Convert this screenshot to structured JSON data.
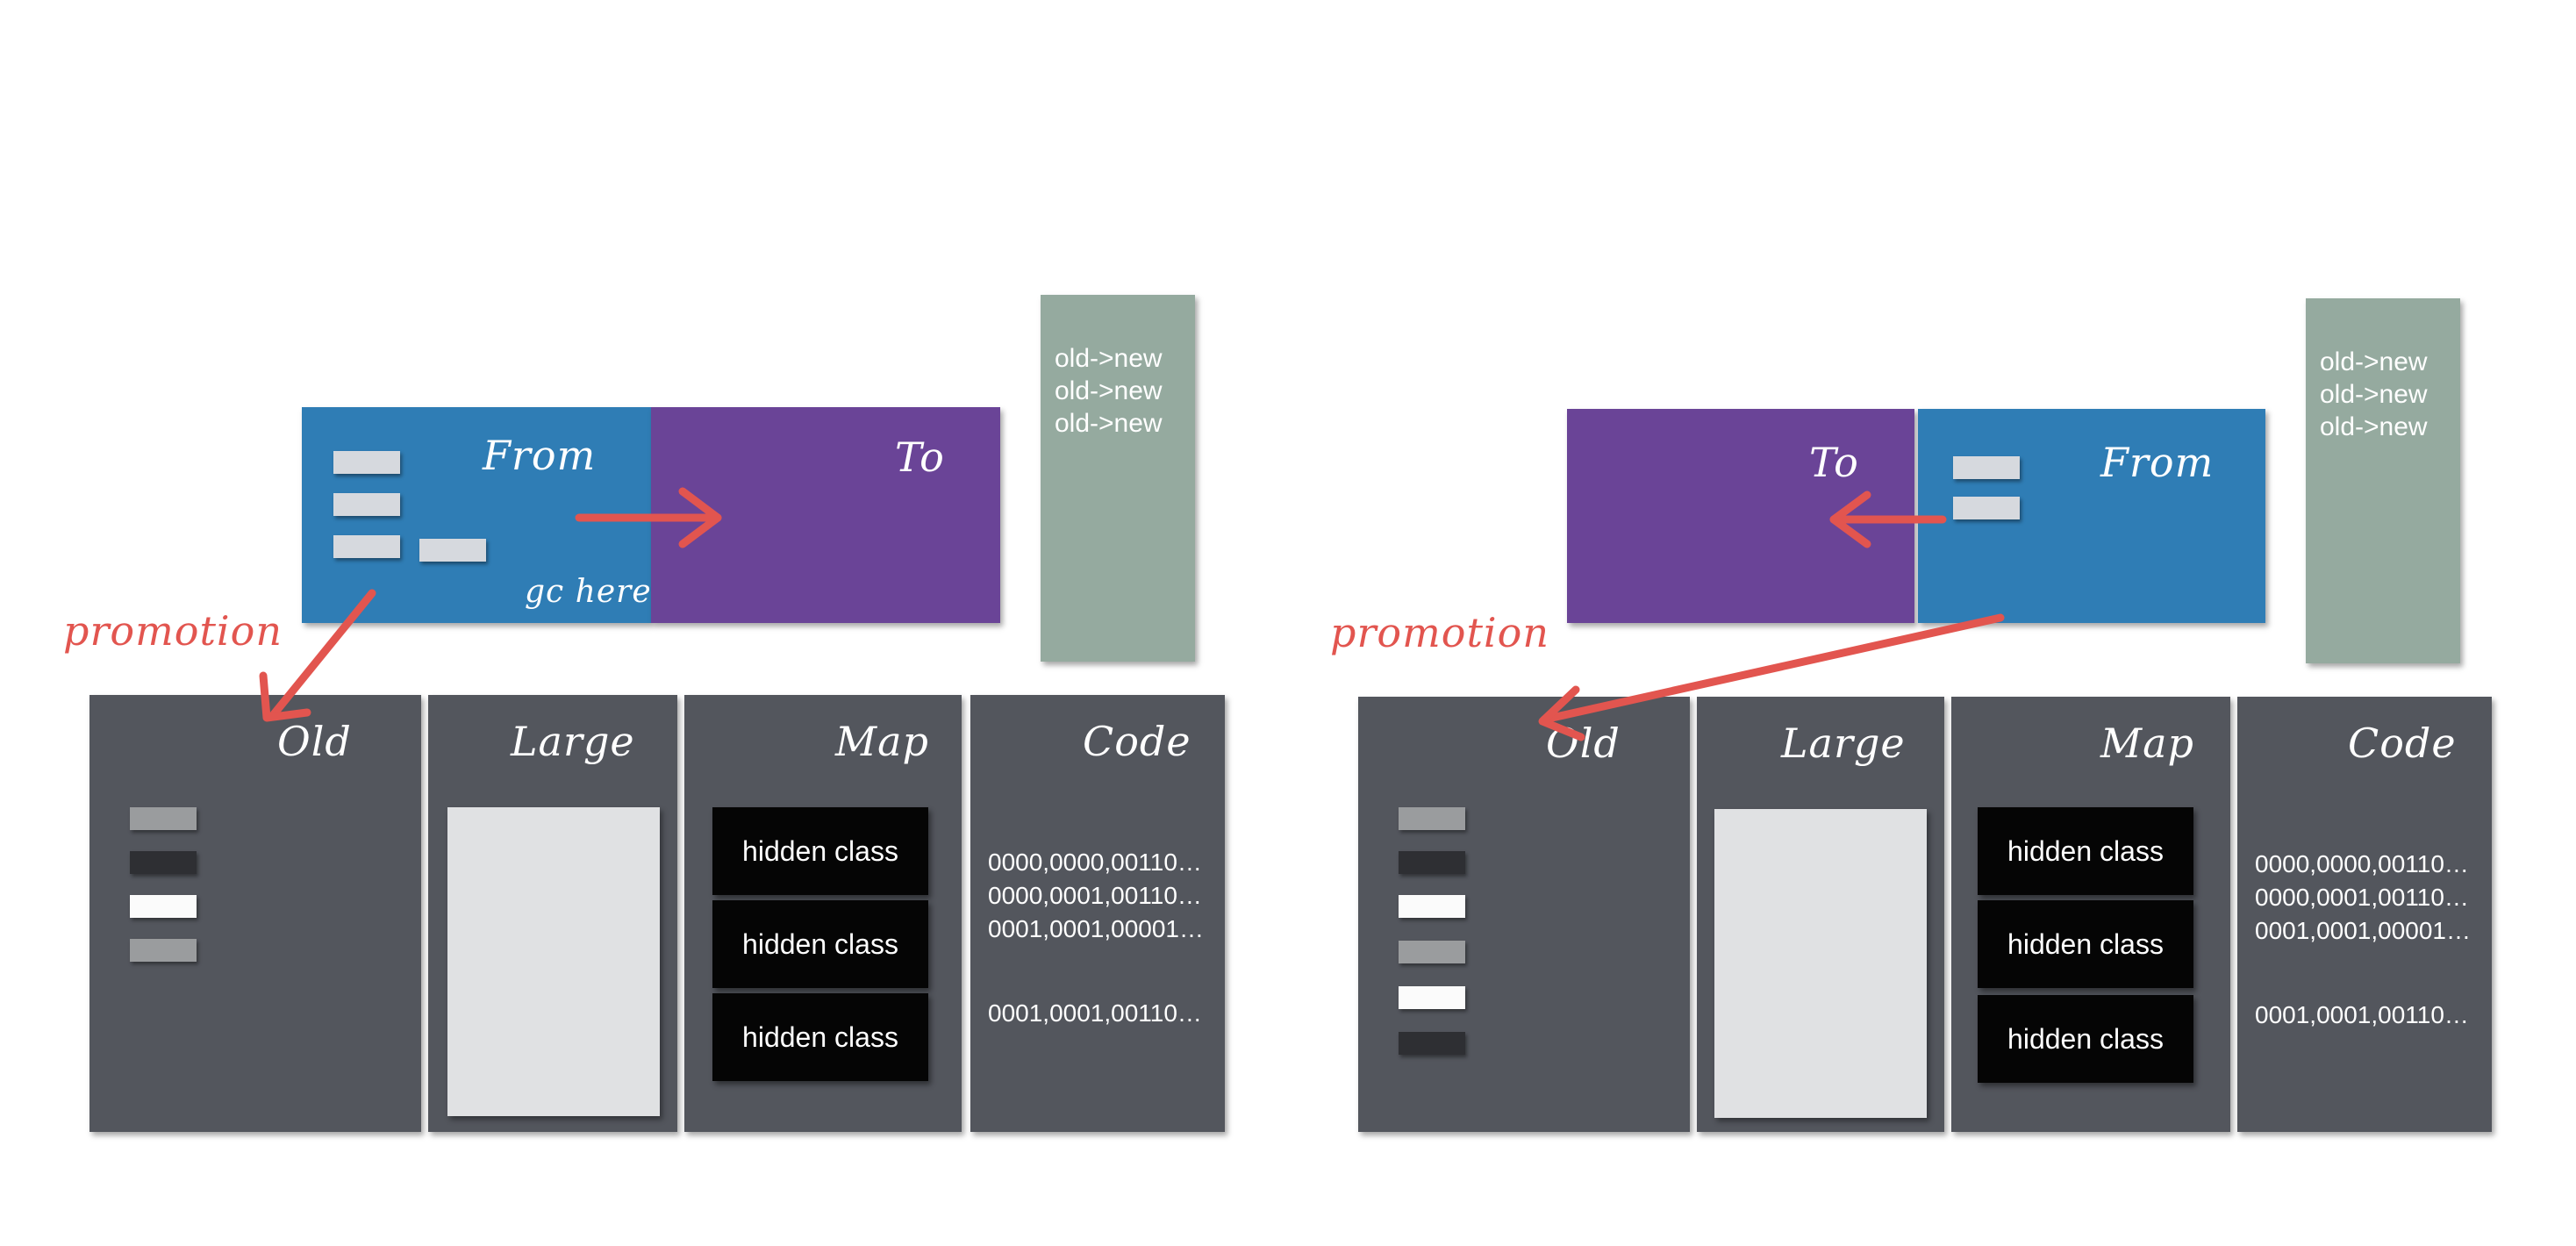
{
  "labels": {
    "from": "From",
    "to": "To",
    "gc_here": "gc here",
    "promotion": "promotion",
    "old": "Old",
    "large": "Large",
    "map": "Map",
    "code": "Code"
  },
  "remembered_set": {
    "entries": [
      "old->new",
      "old->new",
      "old->new"
    ]
  },
  "map_space": {
    "items": [
      "hidden class",
      "hidden class",
      "hidden class"
    ]
  },
  "code_space": {
    "lines": [
      "0000,0000,00110…",
      "0000,0001,00110…",
      "0001,0001,00001…",
      "0001,0001,00110…"
    ]
  },
  "colors": {
    "from_space": "#2f7db5",
    "to_space": "#6a4497",
    "remembered_set": "#95aa9f",
    "old_generation": "#53565d",
    "arrow": "#e2554f"
  }
}
